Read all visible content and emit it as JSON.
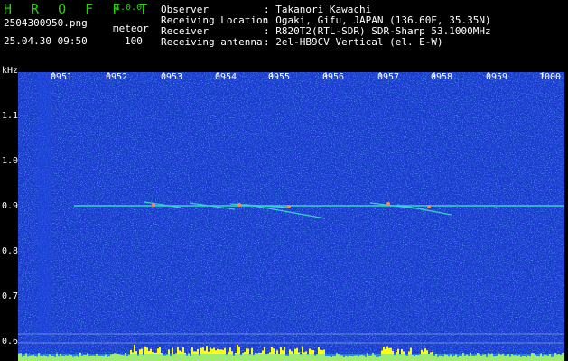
{
  "header": {
    "brand": "H R O F F T",
    "version": "1.0.0",
    "filename": "2504300950.png",
    "mode": "meteor",
    "datetime": "25.04.30 09:50",
    "count": "100"
  },
  "info": [
    {
      "label": "Observer",
      "value": ": Takanori Kawachi"
    },
    {
      "label": "Receiving Location",
      "value": ": Ogaki, Gifu, JAPAN (136.60E, 35.35N)"
    },
    {
      "label": "Receiver",
      "value": ": R820T2(RTL-SDR) SDR-Sharp 53.1000MHz"
    },
    {
      "label": "Receiving antenna",
      "value": ": 2el-HB9CV Vertical (el. E-W)"
    }
  ],
  "axis": {
    "y_unit": "kHz",
    "y_ticks": [
      "1.1",
      "1.0",
      "0.9",
      "0.8",
      "0.7",
      "0.6"
    ],
    "x_ticks": [
      "0951",
      "0952",
      "0953",
      "0954",
      "0955",
      "0956",
      "0957",
      "0958",
      "0959",
      "1000"
    ]
  },
  "colors": {
    "background": "#1a3bd0",
    "brand": "#25d400",
    "carrier": "#33d6c8",
    "baseline": "#ffff00"
  }
}
